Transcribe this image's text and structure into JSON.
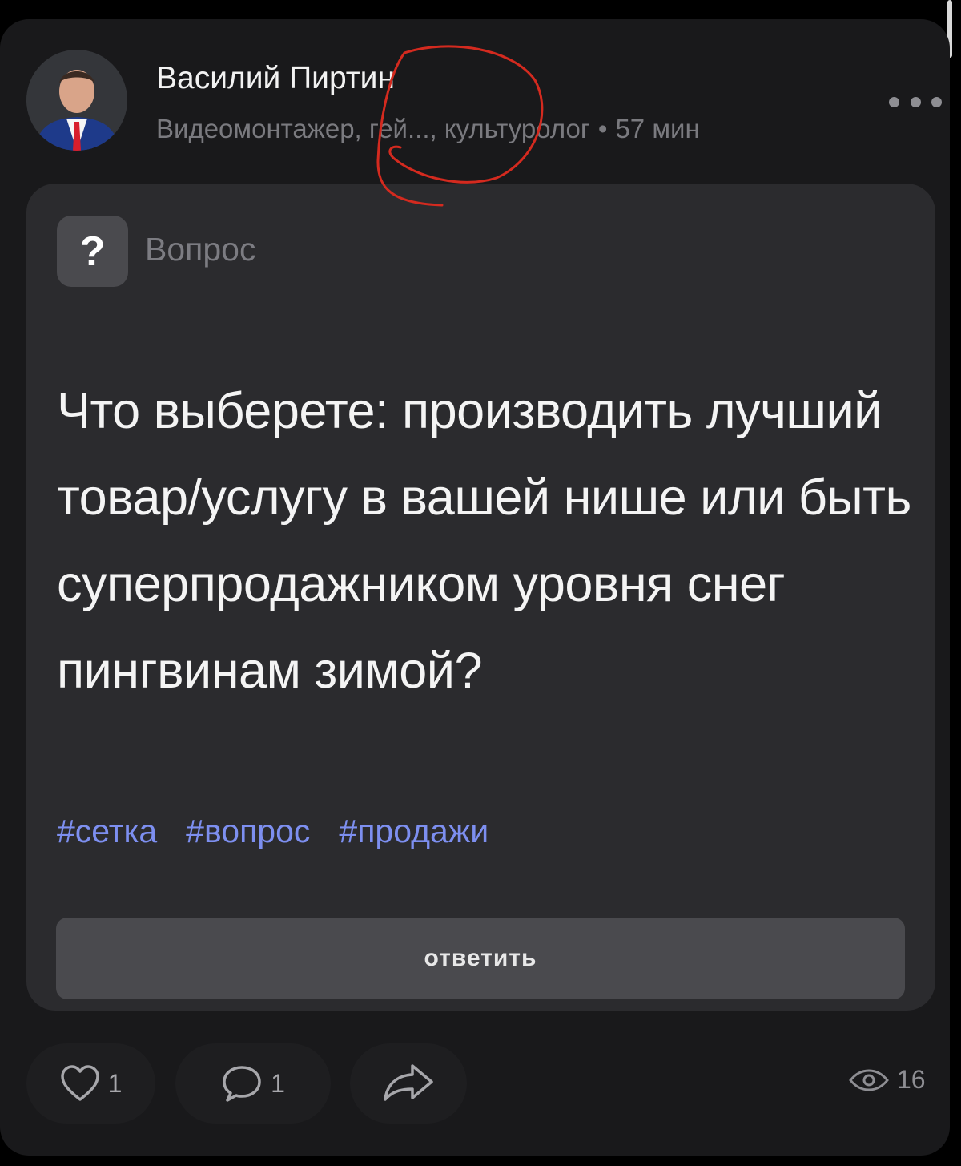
{
  "post": {
    "author": {
      "name": "Василий Пиртин",
      "headline": "Видеомонтажер, гей..., культуролог",
      "separator": "•",
      "time": "57 мин"
    },
    "question": {
      "type_icon": "?",
      "type_label": "Вопрос",
      "text": "Что выберете: производить лучший товар/услугу в вашей нише или быть суперпродажником уровня снег пингвинам зимой?",
      "tags": [
        "#сетка",
        "#вопрос",
        "#продажи"
      ],
      "answer_label": "ответить"
    },
    "stats": {
      "likes": "1",
      "comments": "1",
      "views": "16"
    }
  },
  "colors": {
    "background": "#000000",
    "card": "#19191b",
    "question_card": "#2b2b2e",
    "tag": "#7d8ff0",
    "annotation": "#d42a1f"
  }
}
